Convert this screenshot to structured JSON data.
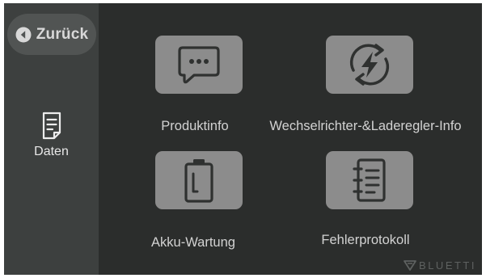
{
  "sidebar": {
    "back_label": "Zurück",
    "active_item": {
      "label": "Daten",
      "icon": "document-icon"
    }
  },
  "tiles": [
    {
      "label": "Produktinfo",
      "icon": "chat-bubble-icon"
    },
    {
      "label": "Wechselrichter-&Laderegler-Info",
      "icon": "lightning-cycle-icon"
    },
    {
      "label": "Akku-Wartung",
      "icon": "battery-icon"
    },
    {
      "label": "Fehlerprotokoll",
      "icon": "log-notebook-icon"
    }
  ],
  "brand": {
    "name": "BLUETTI"
  },
  "colors": {
    "background": "#2b2d2c",
    "sidebar": "#3d403f",
    "back_button": "#515453",
    "tile": "#8c8c8c",
    "icon_stroke": "#2f3130"
  }
}
